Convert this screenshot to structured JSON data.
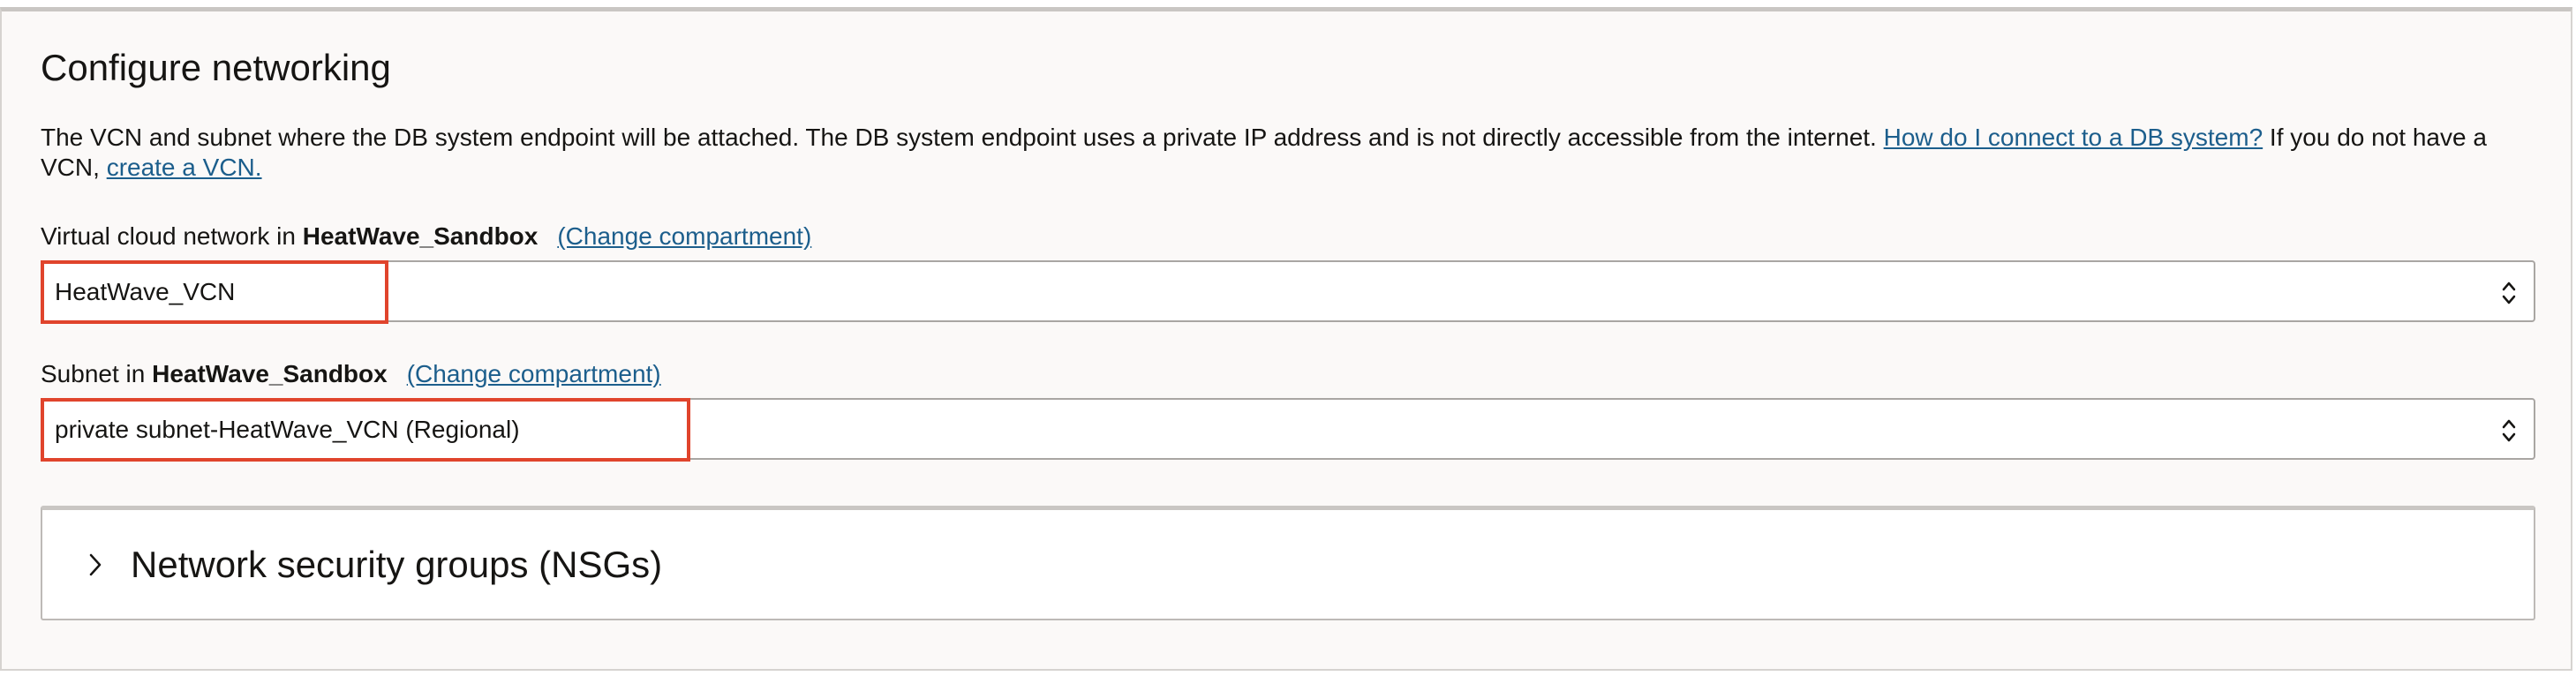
{
  "section": {
    "title": "Configure networking",
    "description_text": "The VCN and subnet where the DB system endpoint will be attached. The DB system endpoint uses a private IP address and is not directly accessible from the internet. ",
    "description_link": "How do I connect to a DB system?",
    "description_text_2": " If you do not have a VCN, ",
    "create_vcn_link": "create a VCN."
  },
  "vcn_field": {
    "label_prefix": "Virtual cloud network in ",
    "compartment": "HeatWave_Sandbox",
    "change_link": "(Change compartment)",
    "value": "HeatWave_VCN"
  },
  "subnet_field": {
    "label_prefix": "Subnet in ",
    "compartment": "HeatWave_Sandbox",
    "change_link": "(Change compartment)",
    "value": "private subnet-HeatWave_VCN (Regional)"
  },
  "nsg_section": {
    "title": "Network security groups (NSGs)"
  },
  "colors": {
    "link": "#1c5e8c",
    "highlight": "#e0442c",
    "panel_background": "#fbf9f8"
  },
  "icons": {
    "select_toggle": "up-down-chevron-icon",
    "expand": "chevron-right-icon"
  }
}
